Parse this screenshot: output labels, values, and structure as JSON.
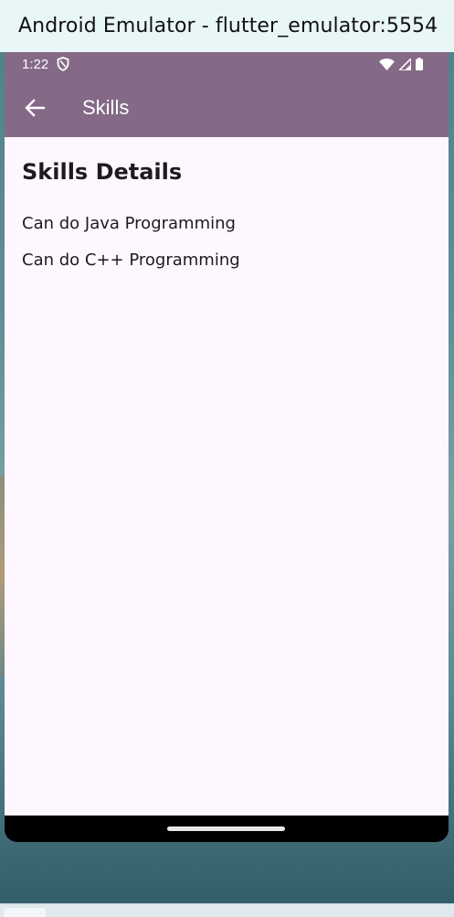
{
  "window": {
    "title": "Android Emulator - flutter_emulator:5554"
  },
  "status_bar": {
    "time": "1:22",
    "icons": [
      "shield-icon",
      "wifi-icon",
      "signal-icon",
      "battery-icon"
    ]
  },
  "app_bar": {
    "title": "Skills",
    "back_icon": "arrow-back-icon",
    "color": "#846a86"
  },
  "page": {
    "heading": "Skills Details",
    "skills": [
      "Can do Java Programming",
      "Can do C++ Programming"
    ],
    "background": "#fef7ff"
  }
}
